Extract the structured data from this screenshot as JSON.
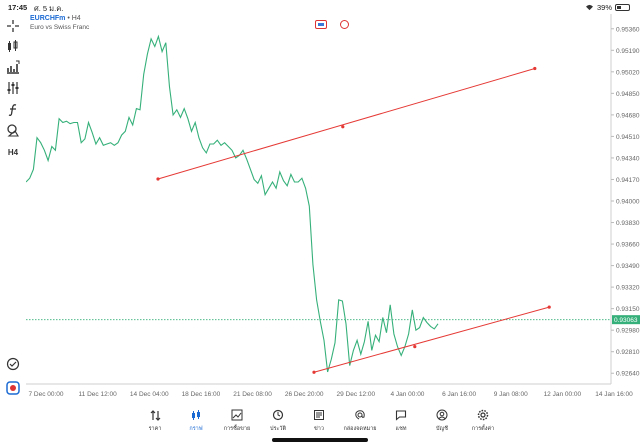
{
  "status": {
    "time": "17:45",
    "date": "ศ. 5 ม.ค.",
    "battery": "39%",
    "battery_level": 0.39
  },
  "toolbar": {
    "items": [
      "crosshair-icon",
      "chart-type-icon",
      "indicators-icon",
      "settings-sliders-icon",
      "function-icon",
      "objects-icon",
      "timeframe"
    ],
    "timeframe_label": "H4"
  },
  "symbol": {
    "name": "EURCHFm",
    "sep": "•",
    "timeframe": "H4",
    "description": "Euro vs Swiss Franc"
  },
  "chart_data": {
    "type": "line",
    "line_color": "#36b07a",
    "current_price": "0.93063",
    "current_price_value": 0.93063,
    "price_ticks": [
      "0.95360",
      "0.95190",
      "0.95020",
      "0.94850",
      "0.94680",
      "0.94510",
      "0.94340",
      "0.94170",
      "0.94000",
      "0.93830",
      "0.93660",
      "0.93490",
      "0.93320",
      "0.93150",
      "0.92980",
      "0.92810",
      "0.92640"
    ],
    "y_range": [
      0.92555,
      0.95445
    ],
    "date_ticks": [
      "7 Dec 00:00",
      "11 Dec 12:00",
      "14 Dec 04:00",
      "18 Dec 16:00",
      "21 Dec 08:00",
      "26 Dec 20:00",
      "29 Dec 12:00",
      "4 Jan 00:00",
      "6 Jan 16:00",
      "9 Jan 08:00",
      "12 Jan 00:00",
      "14 Jan 16:00"
    ],
    "x_range": [
      0,
      125
    ],
    "series": [
      {
        "values": [
          0.9415,
          0.9418,
          0.9425,
          0.945,
          0.9446,
          0.944,
          0.9432,
          0.9443,
          0.944,
          0.9465,
          0.9462,
          0.9463,
          0.9461,
          0.9462,
          0.9462,
          0.9446,
          0.9449,
          0.9462,
          0.9454,
          0.9445,
          0.945,
          0.9444,
          0.9445,
          0.9446,
          0.9444,
          0.9446,
          0.9452,
          0.9455,
          0.9466,
          0.946,
          0.9473,
          0.9472,
          0.95,
          0.9516,
          0.9528,
          0.9522,
          0.953,
          0.9518,
          0.9525,
          0.949,
          0.9468,
          0.9472,
          0.9466,
          0.9473,
          0.9465,
          0.9455,
          0.9462,
          0.945,
          0.9442,
          0.9438,
          0.9445,
          0.9445,
          0.9448,
          0.9444,
          0.9446,
          0.9443,
          0.944,
          0.9434,
          0.9436,
          0.944,
          0.9433,
          0.9425,
          0.9417,
          0.9414,
          0.942,
          0.9405,
          0.941,
          0.9415,
          0.941,
          0.9423,
          0.9416,
          0.9412,
          0.9421,
          0.9415,
          0.9415,
          0.9418,
          0.941,
          0.9396,
          0.935,
          0.9322,
          0.9305,
          0.929,
          0.9265,
          0.9275,
          0.9288,
          0.9322,
          0.9321,
          0.9303,
          0.927,
          0.9282,
          0.929,
          0.9279,
          0.9289,
          0.9305,
          0.9282,
          0.9294,
          0.9289,
          0.9308,
          0.9296,
          0.9318,
          0.9295,
          0.9285,
          0.9278,
          0.9285,
          0.9295,
          0.9314,
          0.9298,
          0.93,
          0.9308,
          0.9304,
          0.9301,
          0.9299,
          0.9303
        ]
      }
    ],
    "trendlines": [
      {
        "color": "#e53935",
        "points": [
          [
            55,
            0.94174
          ],
          [
            132,
            0.94586
          ],
          [
            212,
            0.95046
          ]
        ]
      },
      {
        "color": "#e53935",
        "points": [
          [
            120,
            0.92648
          ],
          [
            162,
            0.9285
          ],
          [
            218,
            0.93162
          ]
        ]
      }
    ]
  },
  "bottom_nav": {
    "items": [
      {
        "icon": "arrows-updown-icon",
        "label": "ราคา",
        "active": false
      },
      {
        "icon": "candles-icon",
        "label": "กราฟ",
        "active": true
      },
      {
        "icon": "trade-chart-icon",
        "label": "การซื้อขาย",
        "active": false
      },
      {
        "icon": "history-icon",
        "label": "ประวัติ",
        "active": false
      },
      {
        "icon": "news-icon",
        "label": "ข่าว",
        "active": false
      },
      {
        "icon": "at-icon",
        "label": "กล่องจดหมาย",
        "active": false
      },
      {
        "icon": "chat-icon",
        "label": "แชท",
        "active": false
      },
      {
        "icon": "account-icon",
        "label": "บัญชี",
        "active": false
      },
      {
        "icon": "gear-icon",
        "label": "การตั้งค่า",
        "active": false
      }
    ]
  },
  "colors": {
    "accent": "#1b6ad3",
    "trendline": "#e53935",
    "price_line": "#36b07a",
    "grid": "#eeeeee"
  }
}
